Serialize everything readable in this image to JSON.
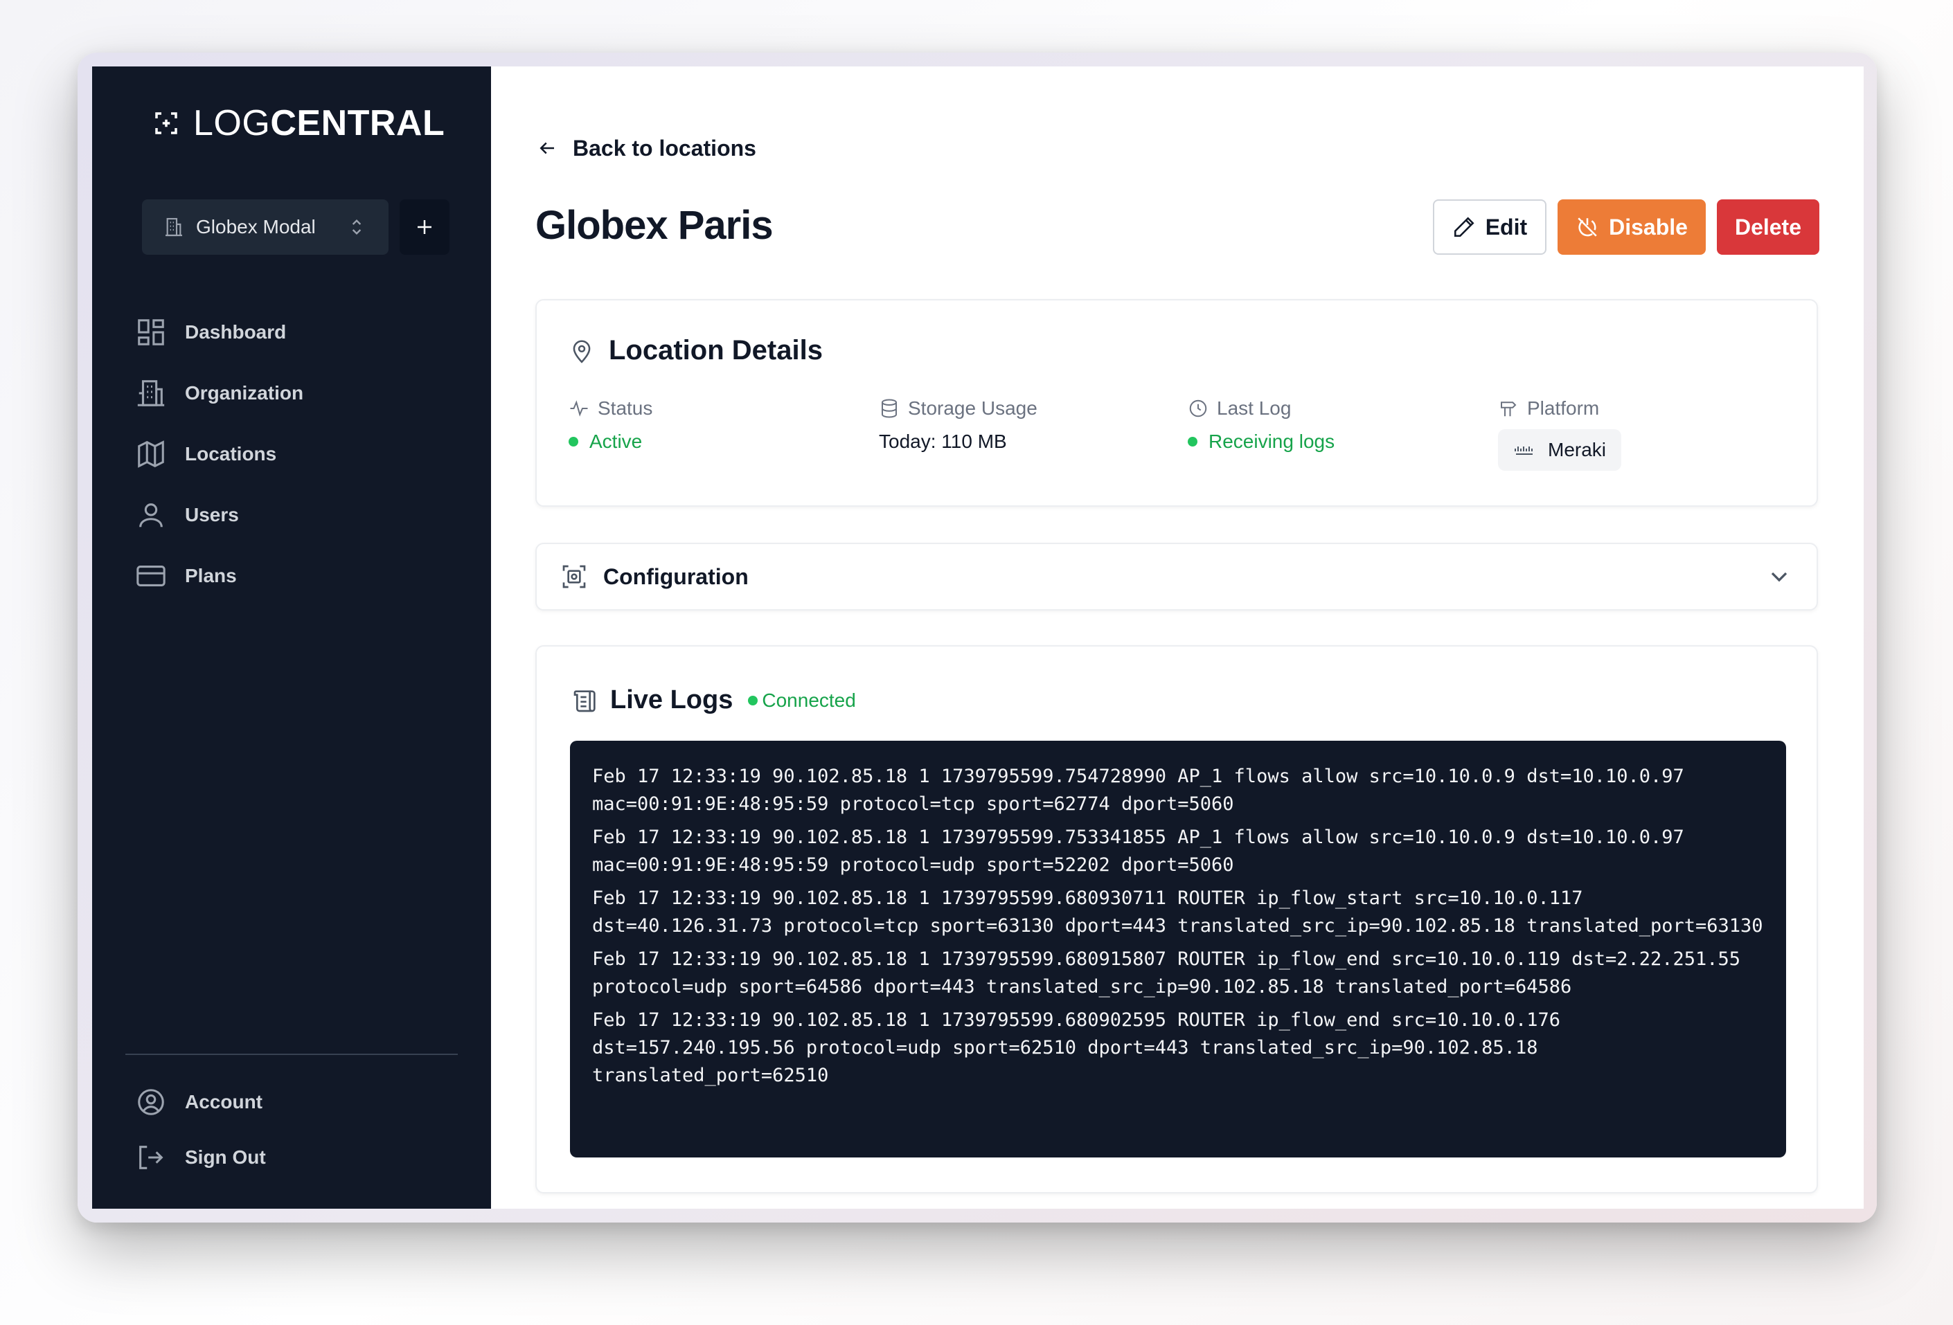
{
  "app": {
    "logo_light": "LOG",
    "logo_bold": "CENTRAL"
  },
  "sidebar": {
    "org_name": "Globex Modal",
    "items": [
      {
        "label": "Dashboard",
        "icon": "dashboard-icon"
      },
      {
        "label": "Organization",
        "icon": "building-icon"
      },
      {
        "label": "Locations",
        "icon": "map-icon"
      },
      {
        "label": "Users",
        "icon": "user-icon"
      },
      {
        "label": "Plans",
        "icon": "credit-card-icon"
      }
    ],
    "bottom": [
      {
        "label": "Account",
        "icon": "user-circle-icon"
      },
      {
        "label": "Sign Out",
        "icon": "sign-out-icon"
      }
    ]
  },
  "header": {
    "back_label": "Back to locations",
    "title": "Globex Paris",
    "edit_label": "Edit",
    "disable_label": "Disable",
    "delete_label": "Delete"
  },
  "details": {
    "title": "Location Details",
    "status_label": "Status",
    "status_value": "Active",
    "storage_label": "Storage Usage",
    "storage_value": "Today: 110 MB",
    "last_log_label": "Last Log",
    "last_log_value": "Receiving logs",
    "platform_label": "Platform",
    "platform_value": "Meraki"
  },
  "config": {
    "title": "Configuration"
  },
  "logs": {
    "title": "Live Logs",
    "status": "Connected",
    "lines": [
      "Feb 17 12:33:19 90.102.85.18 1 1739795599.754728990 AP_1 flows allow src=10.10.0.9 dst=10.10.0.97 mac=00:91:9E:48:95:59 protocol=tcp sport=62774 dport=5060",
      "Feb 17 12:33:19 90.102.85.18 1 1739795599.753341855 AP_1 flows allow src=10.10.0.9 dst=10.10.0.97 mac=00:91:9E:48:95:59 protocol=udp sport=52202 dport=5060",
      "Feb 17 12:33:19 90.102.85.18 1 1739795599.680930711 ROUTER ip_flow_start src=10.10.0.117 dst=40.126.31.73 protocol=tcp sport=63130 dport=443 translated_src_ip=90.102.85.18 translated_port=63130",
      "Feb 17 12:33:19 90.102.85.18 1 1739795599.680915807 ROUTER ip_flow_end src=10.10.0.119 dst=2.22.251.55 protocol=udp sport=64586 dport=443 translated_src_ip=90.102.85.18 translated_port=64586",
      "Feb 17 12:33:19 90.102.85.18 1 1739795599.680902595 ROUTER ip_flow_end src=10.10.0.176 dst=157.240.195.56 protocol=udp sport=62510 dport=443 translated_src_ip=90.102.85.18 translated_port=62510"
    ]
  },
  "colors": {
    "sidebar_bg": "#111827",
    "disable_button": "#ed7c37",
    "delete_button": "#d9373a",
    "status_green": "#16a34a"
  }
}
